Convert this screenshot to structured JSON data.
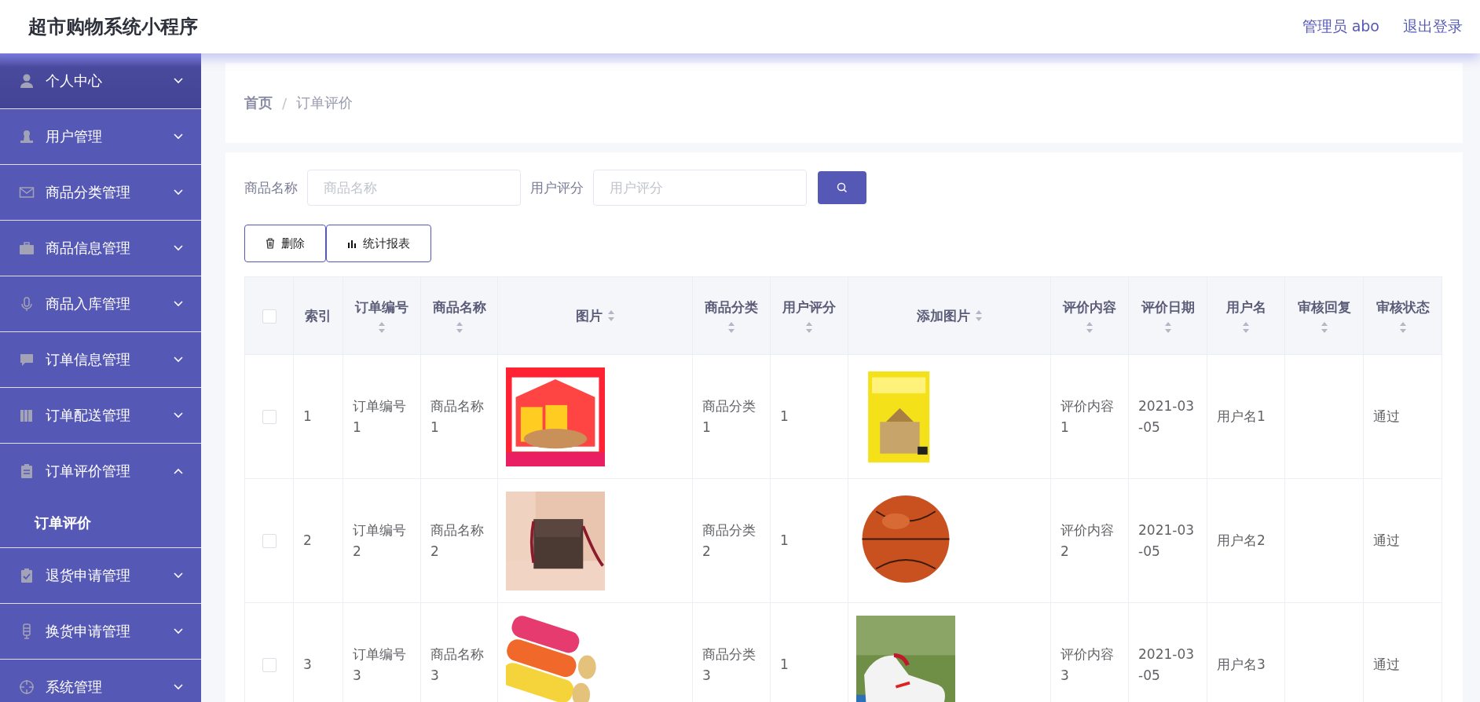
{
  "header": {
    "title": "超市购物系统小程序",
    "user": "管理员 abo",
    "logout": "退出登录"
  },
  "sidebar": {
    "items": [
      {
        "label": "个人中心",
        "expanded": false
      },
      {
        "label": "用户管理",
        "expanded": false
      },
      {
        "label": "商品分类管理",
        "expanded": false
      },
      {
        "label": "商品信息管理",
        "expanded": false
      },
      {
        "label": "商品入库管理",
        "expanded": false
      },
      {
        "label": "订单信息管理",
        "expanded": false
      },
      {
        "label": "订单配送管理",
        "expanded": false
      },
      {
        "label": "订单评价管理",
        "expanded": true,
        "children": [
          {
            "label": "订单评价",
            "selected": true
          }
        ]
      },
      {
        "label": "退货申请管理",
        "expanded": false
      },
      {
        "label": "换货申请管理",
        "expanded": false
      },
      {
        "label": "系统管理",
        "expanded": false
      }
    ]
  },
  "breadcrumb": {
    "home": "首页",
    "separator": "/",
    "current": "订单评价"
  },
  "search": {
    "fields": [
      {
        "label": "商品名称",
        "placeholder": "商品名称"
      },
      {
        "label": "用户评分",
        "placeholder": "用户评分"
      }
    ]
  },
  "actions": [
    {
      "kind": "delete",
      "label": "删除"
    },
    {
      "kind": "report",
      "label": "统计报表"
    }
  ],
  "table": {
    "select_all_checked": false,
    "columns": [
      {
        "label": "索引",
        "sortable": false
      },
      {
        "label": "订单编号",
        "sortable": true
      },
      {
        "label": "商品名称",
        "sortable": true
      },
      {
        "label": "图片",
        "sortable": true
      },
      {
        "label": "商品分类",
        "sortable": true
      },
      {
        "label": "用户评分",
        "sortable": true
      },
      {
        "label": "添加图片",
        "sortable": true
      },
      {
        "label": "评价内容",
        "sortable": true
      },
      {
        "label": "评价日期",
        "sortable": true
      },
      {
        "label": "用户名",
        "sortable": true
      },
      {
        "label": "审核回复",
        "sortable": true
      },
      {
        "label": "审核状态",
        "sortable": true
      }
    ],
    "rows": [
      {
        "checked": false,
        "cells": [
          "1",
          "订单编号1",
          "商品名称1",
          {
            "kind": "picture"
          },
          "商品分类1",
          "1",
          {
            "kind": "picture"
          },
          "评价内容1",
          "2021-03-05",
          "用户名1",
          null,
          "通过"
        ]
      },
      {
        "checked": false,
        "cells": [
          "2",
          "订单编号2",
          "商品名称2",
          {
            "kind": "picture"
          },
          "商品分类2",
          "1",
          {
            "kind": "picture"
          },
          "评价内容2",
          "2021-03-05",
          "用户名2",
          null,
          "通过"
        ]
      },
      {
        "checked": false,
        "cells": [
          "3",
          "订单编号3",
          "商品名称3",
          {
            "kind": "picture"
          },
          "商品分类3",
          "1",
          {
            "kind": "picture"
          },
          "评价内容3",
          "2021-03-05",
          "用户名3",
          null,
          "通过"
        ]
      }
    ]
  }
}
